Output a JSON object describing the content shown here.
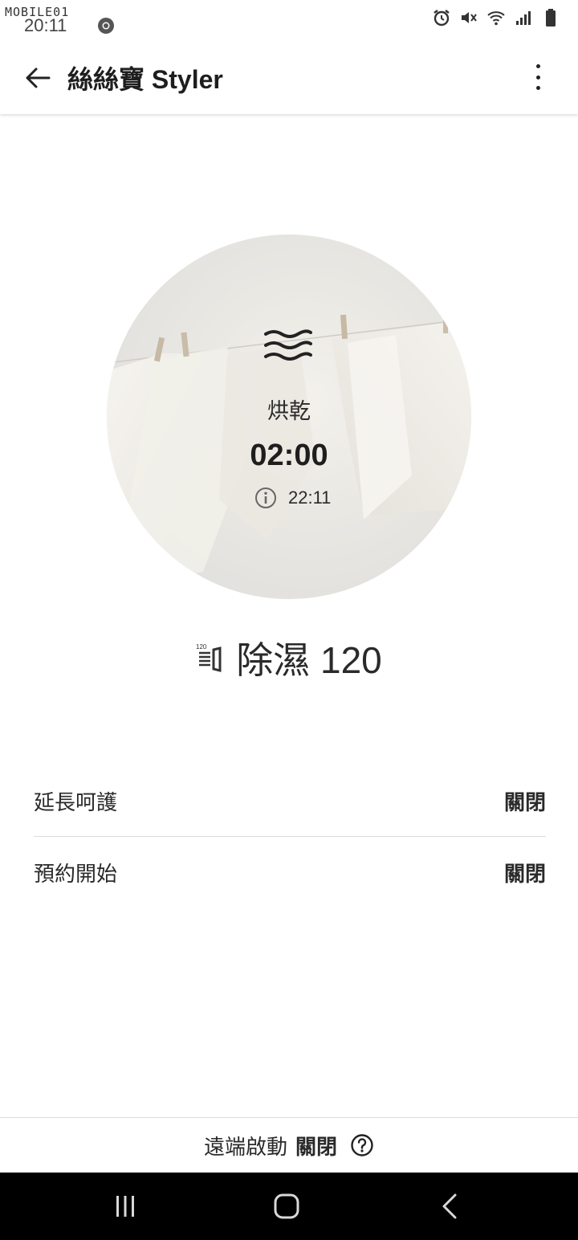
{
  "status_bar": {
    "watermark": "MOBILE01",
    "time": "20:11"
  },
  "header": {
    "title": "絲絲寶 Styler"
  },
  "cycle": {
    "mode": "烘乾",
    "remaining_time": "02:00",
    "end_time": "22:11"
  },
  "course": {
    "name": "除濕 120",
    "icon_badge": "120"
  },
  "settings": [
    {
      "label": "延長呵護",
      "value": "關閉"
    },
    {
      "label": "預約開始",
      "value": "關閉"
    }
  ],
  "remote_start": {
    "label": "遠端啟動",
    "value": "關閉"
  },
  "colors": {
    "text": "#2a2a2a",
    "divider": "#dcdcdc",
    "nav_bar": "#000000"
  }
}
